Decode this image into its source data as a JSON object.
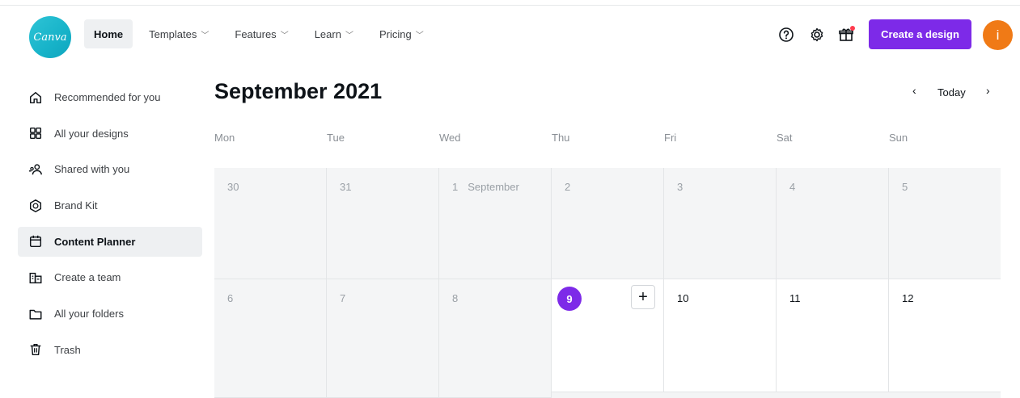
{
  "header": {
    "logo_text": "Canva",
    "nav": [
      {
        "label": "Home",
        "dropdown": false,
        "active": true
      },
      {
        "label": "Templates",
        "dropdown": true
      },
      {
        "label": "Features",
        "dropdown": true
      },
      {
        "label": "Learn",
        "dropdown": true
      },
      {
        "label": "Pricing",
        "dropdown": true
      }
    ],
    "icons": [
      "help-icon",
      "settings-icon",
      "gift-icon"
    ],
    "create_label": "Create a design",
    "avatar_initial": "i"
  },
  "sidebar": {
    "items": [
      {
        "label": "Recommended for you",
        "icon": "home-icon"
      },
      {
        "label": "All your designs",
        "icon": "grid-icon"
      },
      {
        "label": "Shared with you",
        "icon": "people-icon"
      },
      {
        "label": "Brand Kit",
        "icon": "brand-kit-icon"
      },
      {
        "label": "Content Planner",
        "icon": "calendar-icon",
        "active": true
      },
      {
        "label": "Create a team",
        "icon": "team-icon"
      },
      {
        "label": "All your folders",
        "icon": "folder-icon"
      },
      {
        "label": "Trash",
        "icon": "trash-icon"
      }
    ]
  },
  "calendar": {
    "title": "September 2021",
    "prev": "‹",
    "today_label": "Today",
    "next": "›",
    "weekdays": [
      "Mon",
      "Tue",
      "Wed",
      "Thu",
      "Fri",
      "Sat",
      "Sun"
    ],
    "week1": [
      "30",
      "31",
      "1",
      "2",
      "3",
      "4",
      "5"
    ],
    "week1_month_label": "September",
    "week2": [
      "6",
      "7",
      "8",
      "9",
      "10",
      "11",
      "12"
    ],
    "add_symbol": "+"
  },
  "colors": {
    "accent": "#7d2ae8",
    "logo": "#20bfd3",
    "avatar": "#f07a16",
    "notification_dot": "#ff3b4e"
  }
}
